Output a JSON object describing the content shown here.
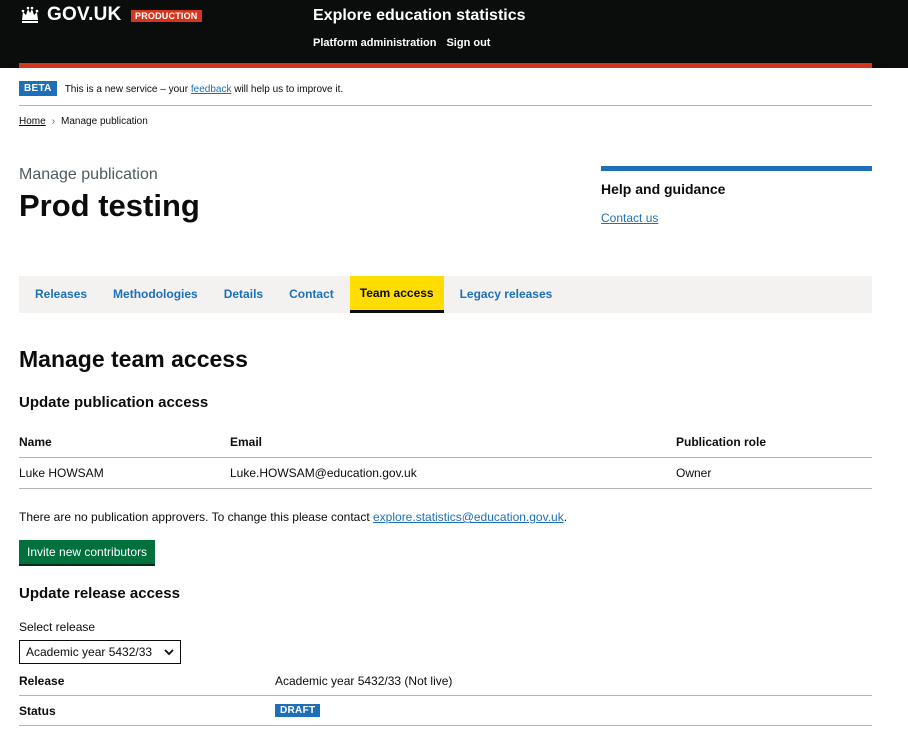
{
  "header": {
    "logo_text": "GOV.UK",
    "env_tag": "PRODUCTION",
    "service_name": "Explore education statistics",
    "nav": [
      "Platform administration",
      "Sign out"
    ]
  },
  "beta_banner": {
    "tag": "BETA",
    "text_before": "This is a new service – your ",
    "link": "feedback",
    "text_after": " will help us to improve it."
  },
  "breadcrumb": {
    "home": "Home",
    "separator": "›",
    "current": "Manage publication"
  },
  "page": {
    "caption": "Manage publication",
    "title": "Prod testing"
  },
  "help": {
    "heading": "Help and guidance",
    "link": "Contact us"
  },
  "tabs": [
    {
      "label": "Releases",
      "active": false
    },
    {
      "label": "Methodologies",
      "active": false
    },
    {
      "label": "Details",
      "active": false
    },
    {
      "label": "Contact",
      "active": false
    },
    {
      "label": "Team access",
      "active": true
    },
    {
      "label": "Legacy releases",
      "active": false
    }
  ],
  "main": {
    "heading": "Manage team access",
    "publication_heading": "Update publication access",
    "table": {
      "headers": [
        "Name",
        "Email",
        "Publication role"
      ],
      "rows": [
        [
          "Luke HOWSAM",
          "Luke.HOWSAM@education.gov.uk",
          "Owner"
        ]
      ]
    },
    "note_text": "There are no publication approvers. To change this please contact ",
    "note_link": "explore.statistics@education.gov.uk",
    "note_end": ".",
    "invite_button": "Invite new contributors",
    "release_heading": "Update release access",
    "select_label": "Select release",
    "select_value": "Academic year 5432/33",
    "summary": {
      "release_key": "Release",
      "release_value": "Academic year 5432/33 (Not live)",
      "status_key": "Status",
      "status_value": "DRAFT"
    }
  },
  "colors": {
    "header_bg": "#0b0c0c",
    "accent_red": "#d4351c",
    "link_blue": "#1d70b8",
    "tab_active": "#ffdd00",
    "button_green": "#00703c"
  }
}
